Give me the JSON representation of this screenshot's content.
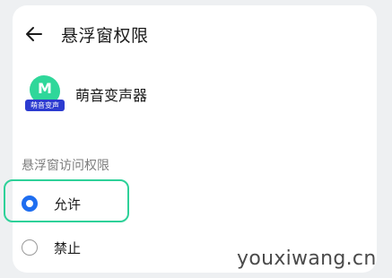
{
  "header": {
    "back_icon": "arrow-left-icon",
    "title": "悬浮窗权限"
  },
  "app": {
    "icon": "app-logo-icon",
    "icon_letters": "M",
    "icon_tag": "萌音变声",
    "name": "萌音变声器",
    "icon_color": "#2fd79a",
    "tag_color": "#2c3bd0"
  },
  "permission": {
    "section_label": "悬浮窗访问权限",
    "options": [
      {
        "label": "允许",
        "selected": true
      },
      {
        "label": "禁止",
        "selected": false
      }
    ],
    "radio_color": "#1f6ef0",
    "highlight_color": "#2ed199"
  },
  "watermark": "youxiwang.cn"
}
